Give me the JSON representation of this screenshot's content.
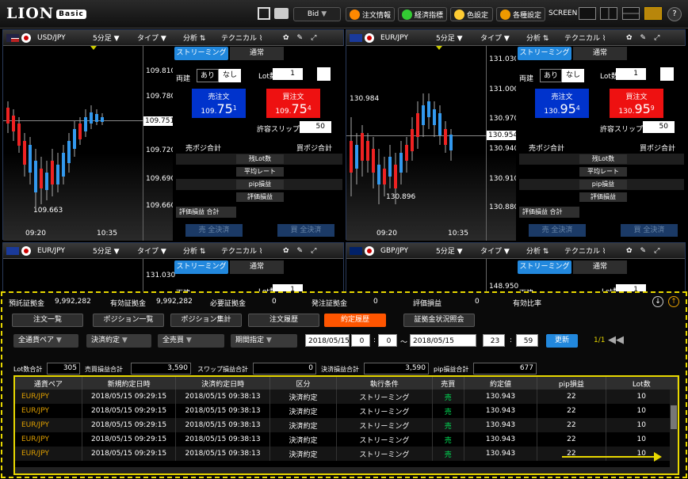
{
  "app": {
    "logo": "LION",
    "logo_badge": "Basic"
  },
  "toolbar": {
    "price_select": "Bid",
    "order_info": "注文情報",
    "econ": "経済指標",
    "color": "色設定",
    "settings": "各種設定",
    "screen": "SCREEN"
  },
  "panels": [
    {
      "pair": "USD/JPY",
      "interval": "5分足",
      "type": "タイプ",
      "analysis": "分析",
      "technical": "テクニカル",
      "streaming": "ストリーミング",
      "normal": "通常",
      "both": "両建",
      "yes": "あり",
      "no": "なし",
      "lot_label": "Lot数",
      "lot": "1",
      "sell_label": "売注文",
      "sell_main": "109.",
      "sell_big": "75",
      "sell_sup": "1",
      "buy_label": "買注文",
      "buy_main": "109.",
      "buy_big": "75",
      "buy_sup": "4",
      "slip_label": "許容スリップ",
      "slip": "50",
      "sell_total": "売ポジ合計",
      "buy_total": "買ポジ合計",
      "rows": [
        "残Lot数",
        "平均レート",
        "pip損益",
        "評価損益"
      ],
      "eval_total": "評価損益 合計",
      "sell_all": "売 全決済",
      "buy_all": "買 全決済",
      "ticks": [
        "109.810",
        "109.780",
        "109.751",
        "109.720",
        "109.690",
        "109.660"
      ],
      "low_label": "109.663",
      "time1": "09:20",
      "time2": "10:35",
      "current": "109.751"
    },
    {
      "pair": "EUR/JPY",
      "interval": "5分足",
      "type": "タイプ",
      "analysis": "分析",
      "technical": "テクニカル",
      "streaming": "ストリーミング",
      "normal": "通常",
      "both": "両建",
      "yes": "あり",
      "no": "なし",
      "lot_label": "Lot数",
      "lot": "1",
      "sell_label": "売注文",
      "sell_main": "130.",
      "sell_big": "95",
      "sell_sup": "4",
      "buy_label": "買注文",
      "buy_main": "130.",
      "buy_big": "95",
      "buy_sup": "9",
      "slip_label": "許容スリップ",
      "slip": "50",
      "sell_total": "売ポジ合計",
      "buy_total": "買ポジ合計",
      "rows": [
        "残Lot数",
        "平均レート",
        "pip損益",
        "評価損益"
      ],
      "eval_total": "評価損益 合計",
      "sell_all": "売 全決済",
      "buy_all": "買 全決済",
      "ticks": [
        "131.030",
        "131.000",
        "130.970",
        "130.954",
        "130.940",
        "130.910",
        "130.880"
      ],
      "high_label": "130.984",
      "low_label": "130.896",
      "time1": "09:20",
      "time2": "10:35",
      "current": "130.954"
    }
  ],
  "panels_lower": [
    {
      "pair": "EUR/JPY",
      "interval": "5分足",
      "type": "タイプ",
      "analysis": "分析",
      "technical": "テクニカル",
      "streaming": "ストリーミング",
      "normal": "通常",
      "tick": "131.030",
      "lot_label": "Lot数",
      "lot": "1",
      "both": "両建"
    },
    {
      "pair": "GBP/JPY",
      "interval": "5分足",
      "type": "タイプ",
      "analysis": "分析",
      "technical": "テクニカル",
      "streaming": "ストリーミング",
      "normal": "通常",
      "tick": "148.950",
      "lot_label": "Lot数",
      "lot": "1",
      "both": "両建"
    }
  ],
  "account": {
    "deposit_label": "預託証拠金",
    "deposit": "9,992,282",
    "valid_label": "有効証拠金",
    "valid": "9,992,282",
    "required_label": "必要証拠金",
    "required": "0",
    "order_label": "発注証拠金",
    "order": "0",
    "eval_label": "評価損益",
    "eval": "0",
    "ratio_label": "有効比率"
  },
  "tabs": [
    "注文一覧",
    "ポジション一覧",
    "ポジション集計",
    "注文履歴",
    "約定履歴",
    "証拠金状況照会"
  ],
  "filters": {
    "pair": "全通貨ペア",
    "kind": "決済約定",
    "side": "全売買",
    "period": "期間指定",
    "from_date": "2018/05/15",
    "from_h": "0",
    "from_m": "0",
    "tilde": "～",
    "to_date": "2018/05/15",
    "to_h": "23",
    "to_m": "59",
    "refresh": "更新",
    "page": "1/1"
  },
  "summary": {
    "lot_label": "Lot数合計",
    "lot": "305",
    "trade_label": "売買損益合計",
    "trade": "3,590",
    "swap_label": "スワップ損益合計",
    "swap": "0",
    "settle_label": "決済損益合計",
    "settle": "3,590",
    "pip_label": "pip損益合計",
    "pip": "677"
  },
  "table": {
    "headers": [
      "通貨ペア",
      "新規約定日時",
      "決済約定日時",
      "区分",
      "執行条件",
      "売買",
      "約定値",
      "pip損益",
      "Lot数"
    ],
    "rows": [
      [
        "EUR/JPY",
        "2018/05/15 09:29:15",
        "2018/05/15 09:38:13",
        "決済約定",
        "ストリーミング",
        "売",
        "130.943",
        "22",
        "10"
      ],
      [
        "EUR/JPY",
        "2018/05/15 09:29:15",
        "2018/05/15 09:38:13",
        "決済約定",
        "ストリーミング",
        "売",
        "130.943",
        "22",
        "10"
      ],
      [
        "EUR/JPY",
        "2018/05/15 09:29:15",
        "2018/05/15 09:38:13",
        "決済約定",
        "ストリーミング",
        "売",
        "130.943",
        "22",
        "10"
      ],
      [
        "EUR/JPY",
        "2018/05/15 09:29:15",
        "2018/05/15 09:38:13",
        "決済約定",
        "ストリーミング",
        "売",
        "130.943",
        "22",
        "10"
      ],
      [
        "EUR/JPY",
        "2018/05/15 09:29:15",
        "2018/05/15 09:38:13",
        "決済約定",
        "ストリーミング",
        "売",
        "130.943",
        "22",
        "10"
      ]
    ]
  },
  "colors": {
    "accent": "#2288dd",
    "sell": "#0033cc",
    "buy": "#ee1111",
    "active_tab": "#ff5500",
    "highlight": "#e8d800"
  }
}
